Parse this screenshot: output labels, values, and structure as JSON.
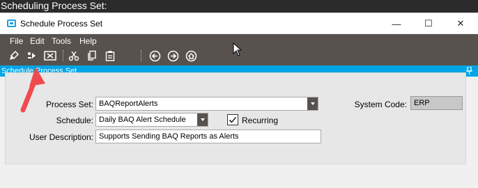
{
  "outer_window": {
    "title": "Scheduling Process Set:"
  },
  "window": {
    "title": "Schedule Process Set",
    "controls": {
      "minimize": "—",
      "maximize": "☐",
      "close": "✕"
    }
  },
  "menu": {
    "items": [
      "File",
      "Edit",
      "Tools",
      "Help"
    ]
  },
  "toolbar": {
    "icons": [
      "clear-icon",
      "process-icon",
      "schedule-icon",
      "cut-icon",
      "copy-icon",
      "paste-icon",
      "back-icon",
      "forward-icon",
      "home-icon"
    ]
  },
  "section": {
    "title": "Schedule Process Set"
  },
  "form": {
    "process_set": {
      "label": "Process Set:",
      "value": "BAQReportAlerts"
    },
    "schedule": {
      "label": "Schedule:",
      "value": "Daily BAQ Alert Schedule"
    },
    "recurring": {
      "label": "Recurring",
      "checked": true
    },
    "user_description": {
      "label": "User Description:",
      "value": "Supports Sending BAQ Reports as Alerts"
    },
    "system_code": {
      "label": "System Code:",
      "value": "ERP"
    }
  },
  "colors": {
    "accent": "#00a5e6",
    "toolbar": "#58524e",
    "annotation_arrow": "#f04a4e"
  }
}
